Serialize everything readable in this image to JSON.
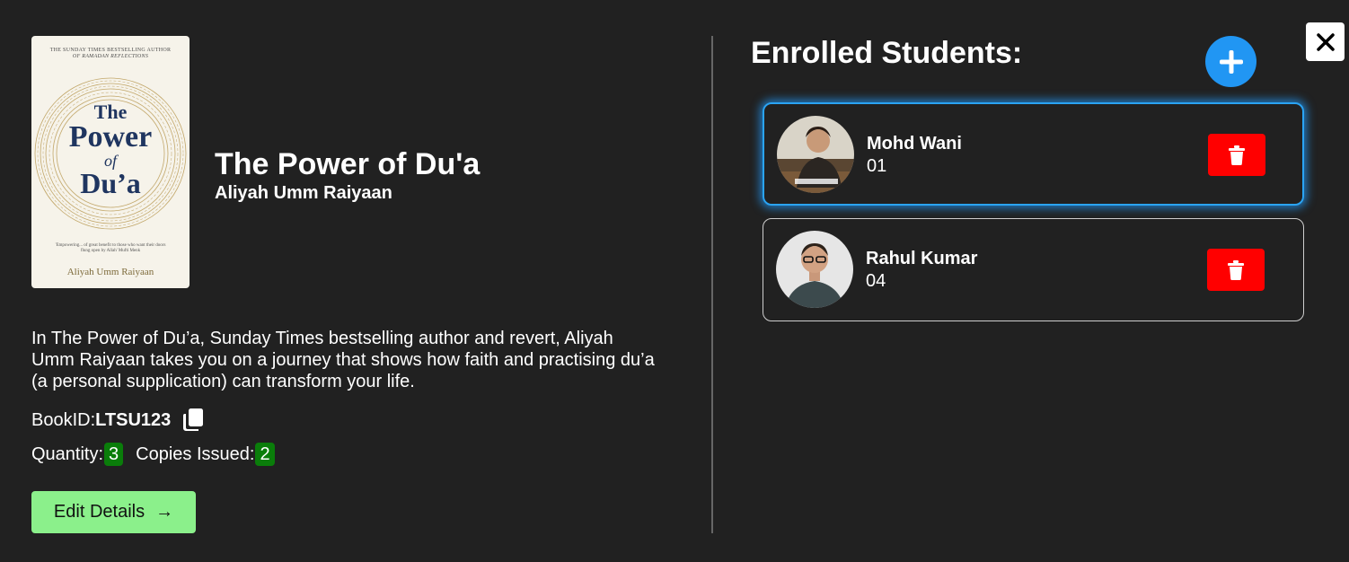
{
  "book": {
    "cover": {
      "tagline_top": "THE SUNDAY TIMES BESTSELLING AUTHOR",
      "tagline_sub": "OF RAMADAN REFLECTIONS",
      "title_line1": "The",
      "title_line2": "Power",
      "title_line3": "of",
      "title_line4": "Du’a",
      "quote": "'Empowering... of great benefit to those who want their doors flung open by Allah' Mufti Menk",
      "author": "Aliyah Umm Raiyaan"
    },
    "title": "The Power of Du'a",
    "author": "Aliyah Umm Raiyaan",
    "description": "In The Power of Du’a, Sunday Times bestselling author and revert, Aliyah Umm Raiyaan takes you on a journey that shows how faith and practising du’a (a personal supplication) can transform your life.",
    "book_id_label": "BookID:",
    "book_id": "LTSU123",
    "quantity_label": "Quantity:",
    "quantity": "3",
    "copies_issued_label": "Copies Issued:",
    "copies_issued": "2",
    "edit_button_label": "Edit Details",
    "edit_button_arrow": "→"
  },
  "enrolled": {
    "title": "Enrolled Students:",
    "students": [
      {
        "name": "Mohd Wani",
        "id": "01",
        "selected": true
      },
      {
        "name": "Rahul Kumar",
        "id": "04",
        "selected": false
      }
    ]
  },
  "icons": {
    "copy": "copy-icon",
    "add": "plus-icon",
    "close": "close-icon",
    "delete": "trash-icon"
  },
  "colors": {
    "background": "#212121",
    "accent_blue": "#2196f3",
    "badge_green": "#0a7d0a",
    "edit_button": "#8bf08b",
    "delete_red": "#ff0000"
  }
}
